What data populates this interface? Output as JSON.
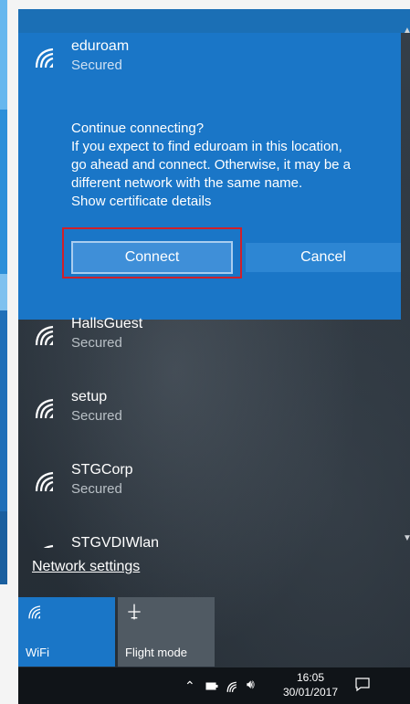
{
  "connected_network": {
    "name": "eduroam",
    "status": "Secured",
    "prompt_title": "Continue connecting?",
    "prompt_lines": [
      "If you expect to find eduroam in this location,",
      "go ahead and connect. Otherwise, it may be a",
      "different network with the same name."
    ],
    "certificate_link": "Show certificate details",
    "connect_label": "Connect",
    "cancel_label": "Cancel"
  },
  "networks": [
    {
      "name": "HallsGuest",
      "status": "Secured"
    },
    {
      "name": "setup",
      "status": "Secured"
    },
    {
      "name": "STGCorp",
      "status": "Secured"
    },
    {
      "name": "STGVDIWlan",
      "status": ""
    }
  ],
  "network_settings_label": "Network settings",
  "quick_actions": {
    "wifi_label": "WiFi",
    "flight_label": "Flight mode"
  },
  "taskbar": {
    "time": "16:05",
    "date": "30/01/2017",
    "icons": [
      "chevron-up-icon",
      "battery-icon",
      "wifi-icon",
      "volume-icon",
      "action-center-icon"
    ]
  },
  "colors": {
    "accent": "#1a76c7",
    "highlight_box": "#d0202a",
    "taskbar": "#101418"
  }
}
